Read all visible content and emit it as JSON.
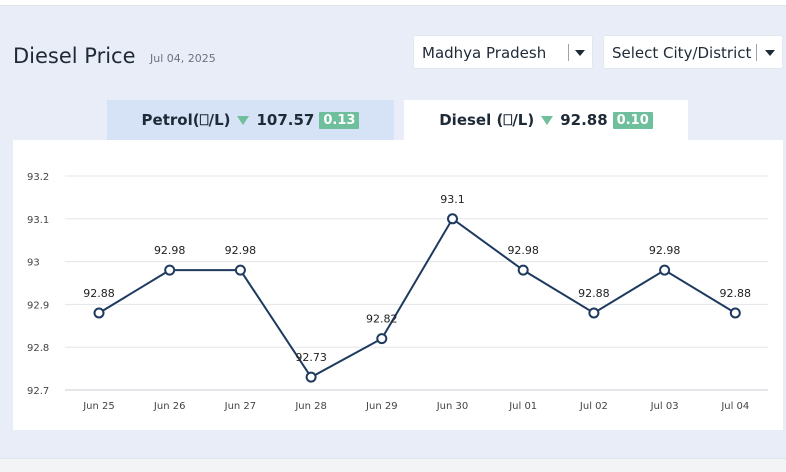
{
  "header": {
    "title": "Diesel Price",
    "date": "Jul 04, 2025"
  },
  "filters": {
    "state": "Madhya Pradesh",
    "city": "Select City/District"
  },
  "tabs": [
    {
      "label": "Petrol(⎕/L)",
      "price": "107.57",
      "change": "0.13",
      "active": false
    },
    {
      "label": "Diesel (⎕/L)",
      "price": "92.88",
      "change": "0.10",
      "active": true
    }
  ],
  "colors": {
    "line": "#1e3a5f",
    "change_badge": "#6fbf9d",
    "active_tab": "#ffffff",
    "inactive_tab": "#d6e2f6"
  },
  "chart_data": {
    "type": "line",
    "categories": [
      "Jun 25",
      "Jun 26",
      "Jun 27",
      "Jun 28",
      "Jun 29",
      "Jun 30",
      "Jul 01",
      "Jul 02",
      "Jul 03",
      "Jul 04"
    ],
    "values": [
      92.88,
      92.98,
      92.98,
      92.73,
      92.82,
      93.1,
      92.98,
      92.88,
      92.98,
      92.88
    ],
    "data_labels": [
      "92.88",
      "92.98",
      "92.98",
      "92.73",
      "92.82",
      "93.1",
      "92.98",
      "92.88",
      "92.98",
      "92.88"
    ],
    "yticks": [
      "93.2",
      "93.1",
      "93",
      "92.9",
      "92.8",
      "92.7"
    ],
    "ylim": [
      92.7,
      93.2
    ],
    "grid": true,
    "title": "",
    "xlabel": "",
    "ylabel": ""
  }
}
